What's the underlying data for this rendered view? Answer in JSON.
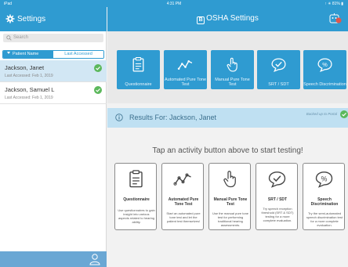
{
  "status_bar": {
    "carrier": "iPad",
    "time": "4:31 PM",
    "battery": "↑ ✳ 81% ▮"
  },
  "nav": {
    "left_title": "Settings",
    "app_logo_letter": "B",
    "app_title": "OSHA Settings"
  },
  "sidebar": {
    "search_placeholder": "Search",
    "sort_options": [
      "Patient Name",
      "Last Accessed"
    ],
    "patients": [
      {
        "name": "Jackson, Janet",
        "last_accessed": "Last Accessed: Feb 1, 2019",
        "selected": true
      },
      {
        "name": "Jackson, Samuel L",
        "last_accessed": "Last Accessed: Feb 1, 2019",
        "selected": false
      }
    ]
  },
  "activities": [
    {
      "label": "Questionnaire",
      "icon": "clipboard-icon"
    },
    {
      "label": "Automated Pure Tone Test",
      "icon": "tone-wave-icon"
    },
    {
      "label": "Manual Pure Tone Test",
      "icon": "hand-pointer-icon"
    },
    {
      "label": "SRT / SDT",
      "icon": "speech-check-icon"
    },
    {
      "label": "Speech Discrimination",
      "icon": "speech-percent-icon"
    }
  ],
  "results": {
    "text": "Results For: Jackson, Janet",
    "backed_up": "Backed up to Portal"
  },
  "prompt": "Tap an activity button above to start testing!",
  "cards": [
    {
      "title": "Questionnaire",
      "desc": "Use questionnaires to gain insight into various aspects related to hearing ability."
    },
    {
      "title": "Automated Pure Tone Test",
      "desc": "Start an automated pure tone test and let the patient test themselves!"
    },
    {
      "title": "Manual Pure Tone Test",
      "desc": "Use the manual pure tone test for performing traditional hearing assessments."
    },
    {
      "title": "SRT / SDT",
      "desc": "Try speech reception threshold (SRT & SDT) testing for a more complete evaluation."
    },
    {
      "title": "Speech Discrimination",
      "desc": "Try the semi-automated speech discrimination test for a more complete evaluation."
    }
  ],
  "colors": {
    "accent": "#2f9bd1",
    "selected_row": "#d2e7f4",
    "success": "#5cb85c",
    "results_bar": "#bfe0f2"
  }
}
